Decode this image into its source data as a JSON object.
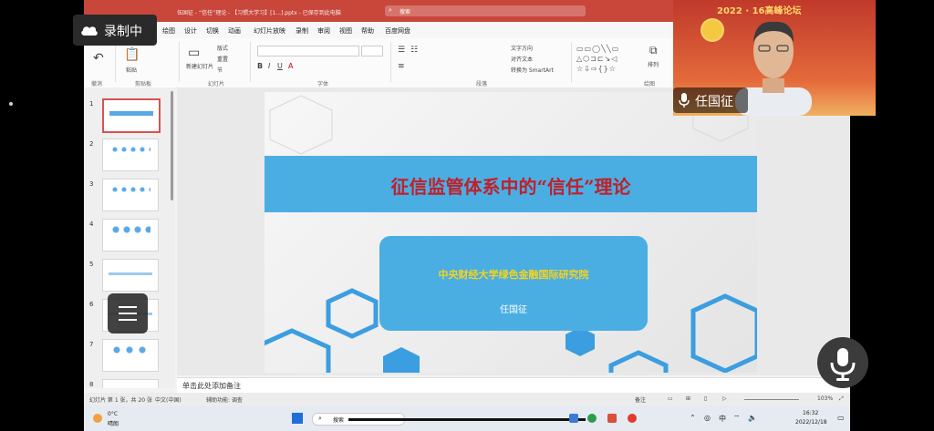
{
  "titlebar": {
    "document": "伍国征 - “信任”理论 - 【习惯大学习】[1...].pptx - 已保存到此电脑",
    "search_placeholder": "搜索"
  },
  "menu": [
    "文件",
    "开始",
    "插入",
    "绘图",
    "设计",
    "切换",
    "动画",
    "幻灯片放映",
    "录制",
    "审阅",
    "视图",
    "帮助",
    "百度网盘"
  ],
  "ribbon": {
    "groups": [
      "撤消",
      "剪贴板",
      "幻灯片",
      "字体",
      "段落",
      "绘图"
    ],
    "paste": "粘贴",
    "new_slide": "新建幻灯片",
    "layout": "版式",
    "reset": "重置",
    "section": "节",
    "text_direction": "文字方向",
    "align_text": "对齐文本",
    "smartart": "转换为 SmartArt",
    "arrange": "排列"
  },
  "thumbnails": [
    "1",
    "2",
    "3",
    "4",
    "5",
    "6",
    "7",
    "8"
  ],
  "slide": {
    "title": "征信监管体系中的“信任”理论",
    "organization": "中央财经大学绿色金融国际研究院",
    "author": "任国征"
  },
  "notes_placeholder": "单击此处添加备注",
  "statusbar": {
    "slide_count": "幻灯片 第 1 张，共 20 张",
    "language": "中文(中国)",
    "accessibility": "辅助功能: 调查",
    "notes": "备注",
    "zoom": "103%"
  },
  "taskbar": {
    "weather_temp": "0°C",
    "weather_desc": "晴朗",
    "search": "搜索",
    "ime": "中",
    "time": "16:32",
    "date": "2022/12/18"
  },
  "overlay": {
    "recording": "录制中",
    "speaker": "任国征",
    "video_banner": "2022 · 16高峰论坛"
  },
  "colors": {
    "accent_red": "#c8463a",
    "slide_blue": "#4aaee3",
    "title_red": "#c0202a",
    "org_yellow": "#f4d21f"
  }
}
